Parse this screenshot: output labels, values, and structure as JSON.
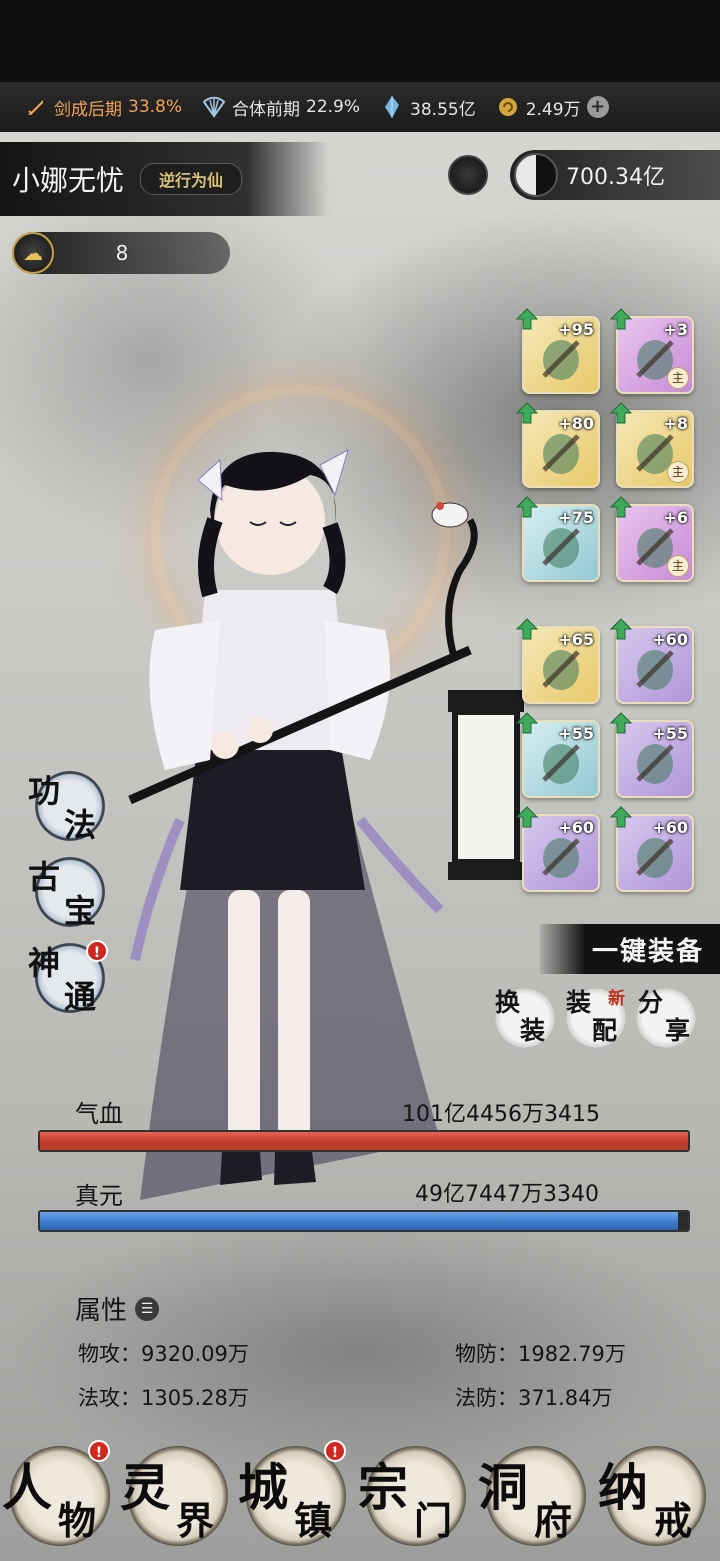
{
  "resources": {
    "realm1_label": "剑成后期",
    "realm1_pct": "33.8%",
    "realm2_label": "合体前期",
    "realm2_pct": "22.9%",
    "crystal": "38.55亿",
    "coin": "2.49万",
    "plus_label": "+"
  },
  "player": {
    "name": "小娜无忧",
    "title": "逆行为仙",
    "currency": "700.34亿",
    "level": "8"
  },
  "equipment": [
    {
      "level": "+95",
      "rarity": "gold"
    },
    {
      "level": "+3",
      "rarity": "purple",
      "tag": "主"
    },
    {
      "level": "+80",
      "rarity": "gold"
    },
    {
      "level": "+8",
      "rarity": "gold",
      "tag": "主"
    },
    {
      "level": "+75",
      "rarity": "blue"
    },
    {
      "level": "+6",
      "rarity": "purple",
      "tag": "主"
    },
    {
      "level": "+65",
      "rarity": "gold"
    },
    {
      "level": "+60",
      "rarity": "violet"
    },
    {
      "level": "+55",
      "rarity": "blue"
    },
    {
      "level": "+55",
      "rarity": "violet"
    },
    {
      "level": "+60",
      "rarity": "violet"
    },
    {
      "level": "+60",
      "rarity": "violet"
    }
  ],
  "actions": {
    "one_key_equip": "一键装备",
    "swap_1": "换",
    "swap_2": "装",
    "config_1": "装",
    "config_2": "配",
    "config_new": "新",
    "share_1": "分",
    "share_2": "享"
  },
  "side_menu": {
    "gongfa_1": "功",
    "gongfa_2": "法",
    "gubao_1": "古",
    "gubao_2": "宝",
    "shentong_1": "神",
    "shentong_2": "通",
    "badge": "!"
  },
  "stats": {
    "hp_label": "气血",
    "hp_value": "101亿4456万3415",
    "hp_fill": 1.0,
    "mp_label": "真元",
    "mp_value": "49亿7447万3340",
    "mp_fill": 0.985
  },
  "attributes": {
    "title": "属性",
    "phys_atk": "物攻：9320.09万",
    "phys_def": "物防：1982.79万",
    "mag_atk": "法攻：1305.28万",
    "mag_def": "法防：371.84万"
  },
  "nav": [
    {
      "c1": "人",
      "c2": "物"
    },
    {
      "c1": "灵",
      "c2": "界"
    },
    {
      "c1": "城",
      "c2": "镇"
    },
    {
      "c1": "宗",
      "c2": "门"
    },
    {
      "c1": "洞",
      "c2": "府"
    },
    {
      "c1": "纳",
      "c2": "戒"
    }
  ],
  "colors": {
    "hp": "#c0392b",
    "mp": "#3b78c8",
    "realm_accent": "#f0a257",
    "badge_red": "#d0281f"
  }
}
